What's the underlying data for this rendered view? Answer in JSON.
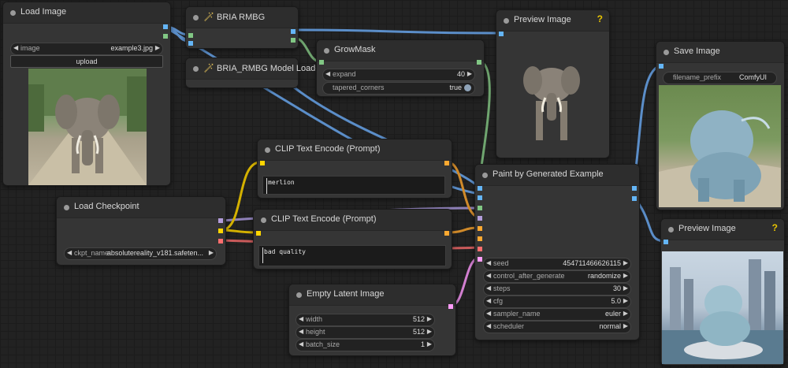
{
  "nodes": {
    "load_image": {
      "title": "Load Image",
      "image_label": "image",
      "image_value": "example3.jpg",
      "upload_label": "upload"
    },
    "bria_rmbg": {
      "title": "BRIA RMBG"
    },
    "bria_loader": {
      "title": "BRIA_RMBG Model Loader"
    },
    "grow_mask": {
      "title": "GrowMask",
      "expand_label": "expand",
      "expand_value": "40",
      "tapered_label": "tapered_corners",
      "tapered_value": "true"
    },
    "preview_1": {
      "title": "Preview Image",
      "help": "?"
    },
    "save_image": {
      "title": "Save Image",
      "prefix_label": "filename_prefix",
      "prefix_value": "ComfyUI"
    },
    "clip_pos": {
      "title": "CLIP Text Encode (Prompt)",
      "text": "merlion"
    },
    "clip_neg": {
      "title": "CLIP Text Encode (Prompt)",
      "text": "bad quality"
    },
    "load_checkpoint": {
      "title": "Load Checkpoint",
      "ckpt_label": "ckpt_name",
      "ckpt_value": "absolutereality_v181.safeten..."
    },
    "paint": {
      "title": "Paint by Generated Example",
      "widgets": [
        {
          "label": "seed",
          "value": "454711466626115"
        },
        {
          "label": "control_after_generate",
          "value": "randomize"
        },
        {
          "label": "steps",
          "value": "30"
        },
        {
          "label": "cfg",
          "value": "5.0"
        },
        {
          "label": "sampler_name",
          "value": "euler"
        },
        {
          "label": "scheduler",
          "value": "normal"
        }
      ]
    },
    "empty_latent": {
      "title": "Empty Latent Image",
      "widgets": [
        {
          "label": "width",
          "value": "512"
        },
        {
          "label": "height",
          "value": "512"
        },
        {
          "label": "batch_size",
          "value": "1"
        }
      ]
    },
    "preview_2": {
      "title": "Preview Image",
      "help": "?"
    }
  },
  "colors": {
    "image_port": "#64b5f6",
    "mask_port": "#81c784",
    "model_port": "#b39ddb",
    "clip_port": "#ffd500",
    "vae_port": "#ff6e6e",
    "conditioning_port": "#ffa931",
    "latent_port": "#ff9cf9",
    "help": "#e8c400"
  },
  "icons": {
    "wand": "magic-wand-icon",
    "arrow_left": "◀",
    "arrow_right": "▶"
  }
}
